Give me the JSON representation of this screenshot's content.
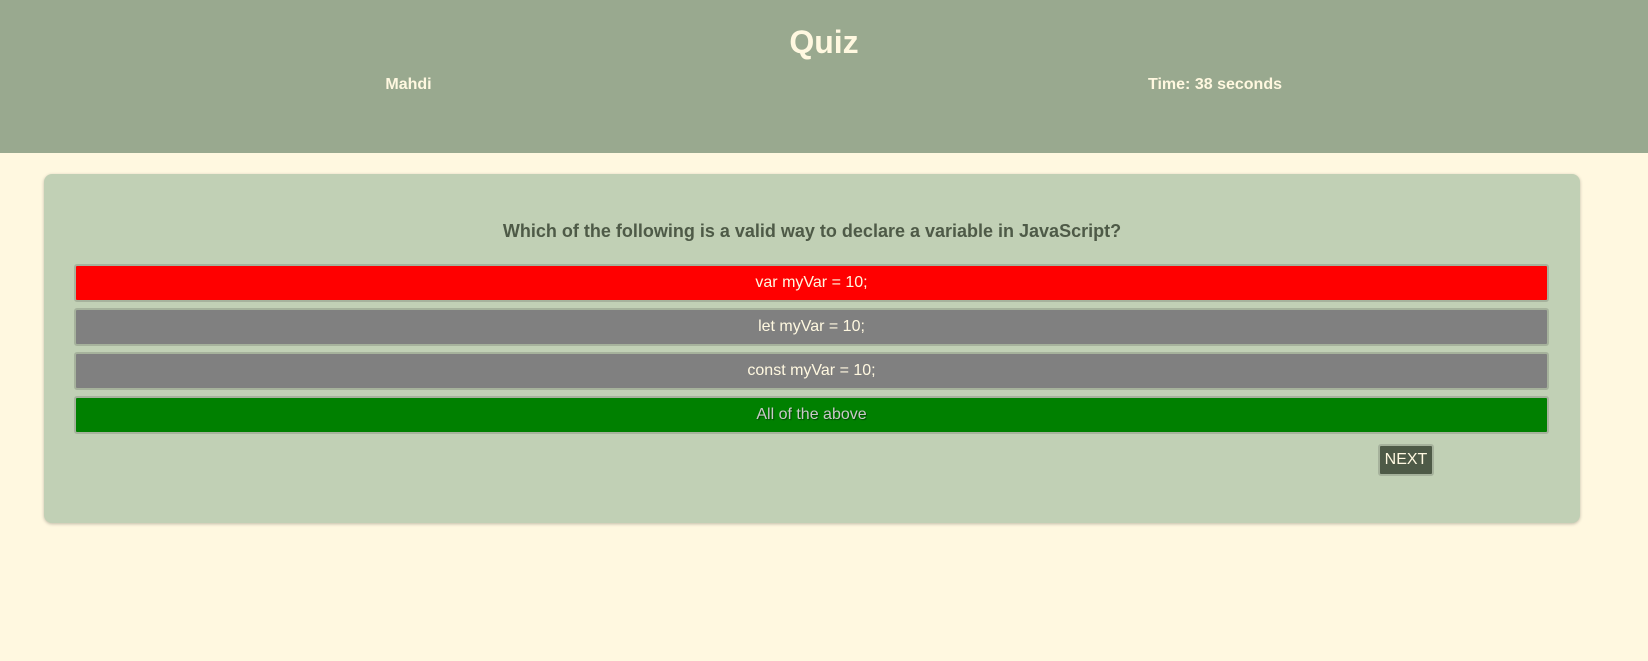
{
  "header": {
    "title": "Quiz",
    "user": "Mahdi",
    "time": "Time: 38 seconds"
  },
  "quiz": {
    "question": "Which of the following is a valid way to declare a variable in JavaScript?",
    "options": [
      {
        "label": "var myVar = 10;",
        "state": "incorrect-selected",
        "color": "#ff0000"
      },
      {
        "label": "let myVar = 10;",
        "state": "neutral",
        "color": "#808080"
      },
      {
        "label": "const myVar = 10;",
        "state": "neutral",
        "color": "#808080"
      },
      {
        "label": "All of the above",
        "state": "correct",
        "color": "#008000"
      }
    ],
    "next_label": "NEXT"
  },
  "colors": {
    "header_bg": "#99a98f",
    "page_bg": "#fff8e0",
    "card_bg": "#c1d0b5",
    "accent_dark": "#4e5a47"
  }
}
